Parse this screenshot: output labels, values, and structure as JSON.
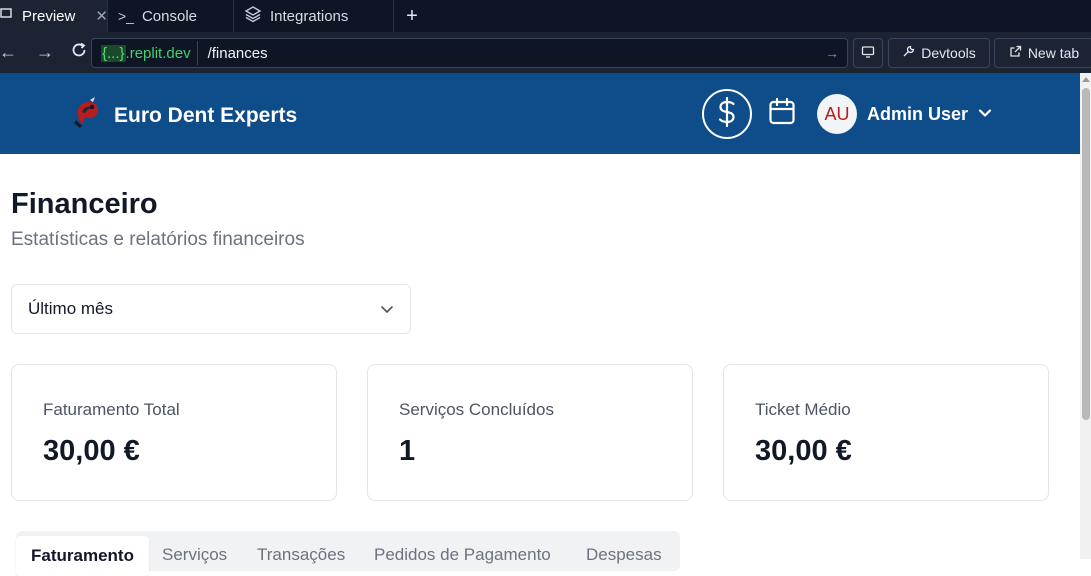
{
  "browser": {
    "tabs": [
      {
        "label": "Preview",
        "active": true,
        "closable": true
      },
      {
        "label": "Console",
        "active": false
      },
      {
        "label": "Integrations",
        "active": false
      }
    ],
    "new_tab_symbol": "+",
    "address": {
      "domain_brace": "{...}",
      "domain": ".replit.dev",
      "path": "/finances"
    },
    "devtools_label": "Devtools",
    "new_tab_label": "New tab"
  },
  "header": {
    "brand": "Euro Dent Experts",
    "avatar_initials": "AU",
    "user_name": "Admin User",
    "icons": [
      "dollar-circle-icon",
      "calendar-icon",
      "chevron-down-icon"
    ]
  },
  "main": {
    "title": "Financeiro",
    "subtitle": "Estatísticas e relatórios financeiros",
    "period_select": {
      "value": "Último mês"
    },
    "cards": [
      {
        "label": "Faturamento Total",
        "value": "30,00 €"
      },
      {
        "label": "Serviços Concluídos",
        "value": "1"
      },
      {
        "label": "Ticket Médio",
        "value": "30,00 €"
      }
    ],
    "tabs": [
      {
        "label": "Faturamento",
        "active": true
      },
      {
        "label": "Serviços",
        "active": false
      },
      {
        "label": "Transações",
        "active": false
      },
      {
        "label": "Pedidos de Pagamento",
        "active": false
      },
      {
        "label": "Despesas",
        "active": false
      }
    ]
  },
  "colors": {
    "header_bg": "#0f4c8a",
    "browser_chrome": "#1c2333",
    "domain_green": "#3fd26a",
    "avatar_text": "#b91c1c"
  }
}
